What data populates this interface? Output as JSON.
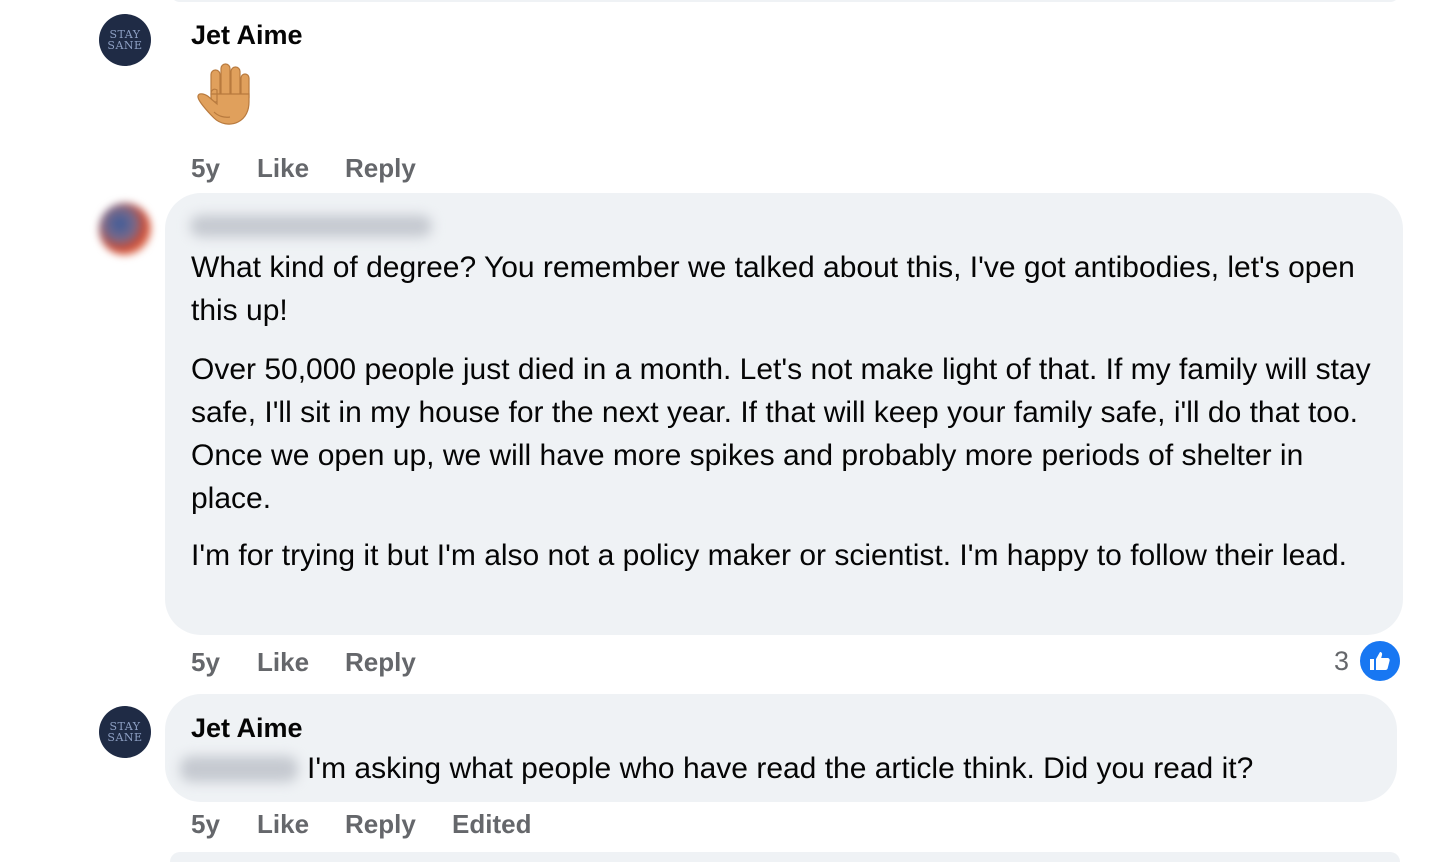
{
  "comments": [
    {
      "author": "Jet Aime",
      "avatar_lines": [
        "STAY",
        "SANE"
      ],
      "emoji": "raised-hand",
      "actions": {
        "time": "5y",
        "like": "Like",
        "reply": "Reply"
      }
    },
    {
      "author_blurred": true,
      "paragraphs": [
        "What kind of degree? You remember we talked about this, I've got antibodies, let's open this up!",
        "Over 50,000 people just died in a month. Let's not make light of that. If my family will stay safe, I'll sit in my house for the next year. If that will keep your family safe, i'll do that too. Once we open up, we will have more spikes and probably more periods of shelter in place.",
        "I'm for trying it but I'm also not a policy maker or scientist. I'm happy to follow their lead."
      ],
      "actions": {
        "time": "5y",
        "like": "Like",
        "reply": "Reply"
      },
      "reaction_count": "3",
      "reaction_icon": "thumbs-up-icon"
    },
    {
      "author": "Jet Aime",
      "avatar_lines": [
        "STAY",
        "SANE"
      ],
      "mention_blurred": true,
      "text": "I'm asking what people who have read the article think. Did you read it?",
      "actions": {
        "time": "5y",
        "like": "Like",
        "reply": "Reply",
        "edited": "Edited"
      }
    }
  ],
  "colors": {
    "bubble": "#eff2f5",
    "secondary_text": "#65676b",
    "like_blue": "#1877f2",
    "avatar_navy": "#1f2b45"
  }
}
